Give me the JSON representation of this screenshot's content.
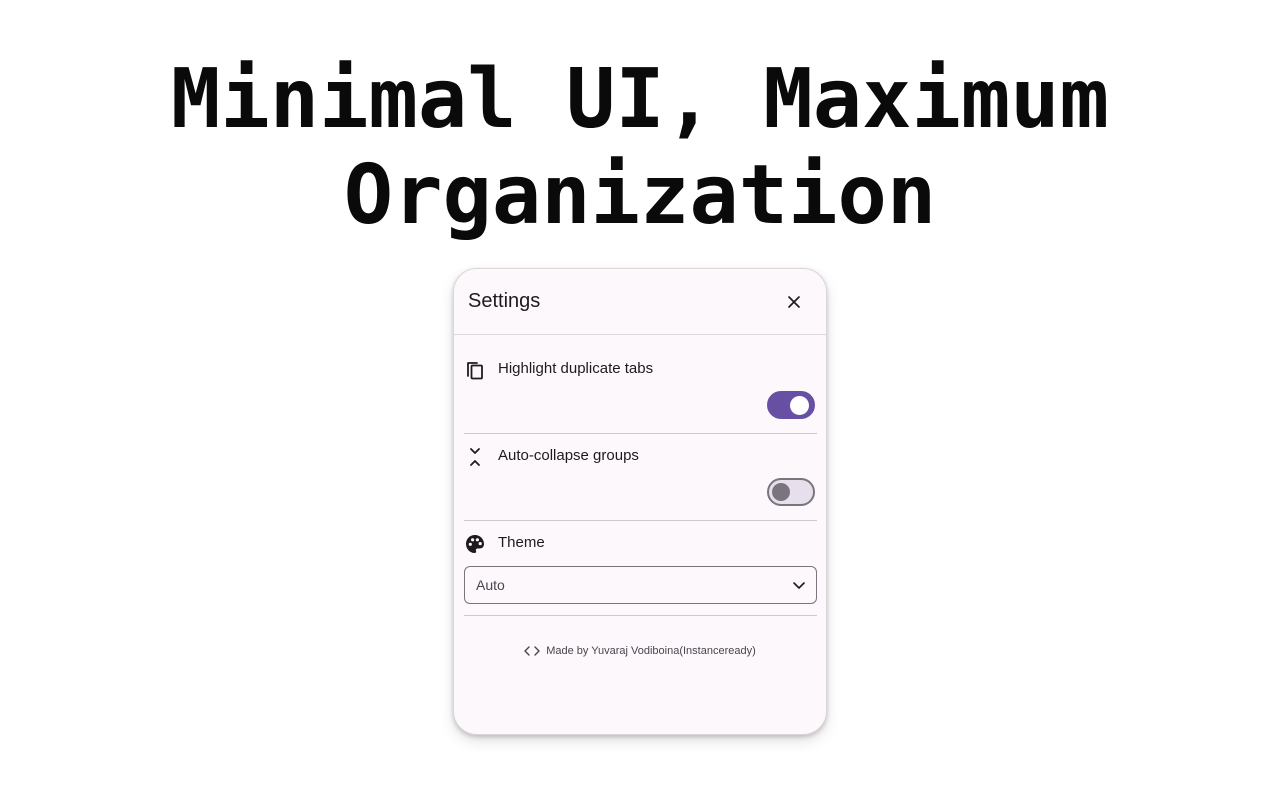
{
  "headline": {
    "line1": "Minimal UI, Maximum",
    "line2": "Organization"
  },
  "settings": {
    "title": "Settings",
    "close_icon": "close-icon",
    "items": [
      {
        "icon": "copy-icon",
        "label": "Highlight duplicate tabs",
        "enabled": true
      },
      {
        "icon": "collapse-icon",
        "label": "Auto-collapse groups",
        "enabled": false
      }
    ],
    "theme": {
      "icon": "palette-icon",
      "label": "Theme",
      "selected": "Auto"
    },
    "footer": {
      "icon": "code-icon",
      "text": "Made by Yuvaraj Vodiboina(Instanceready)"
    }
  },
  "colors": {
    "accent": "#6750a4",
    "panel_background": "#fdf8fc",
    "outline": "#79747e"
  }
}
